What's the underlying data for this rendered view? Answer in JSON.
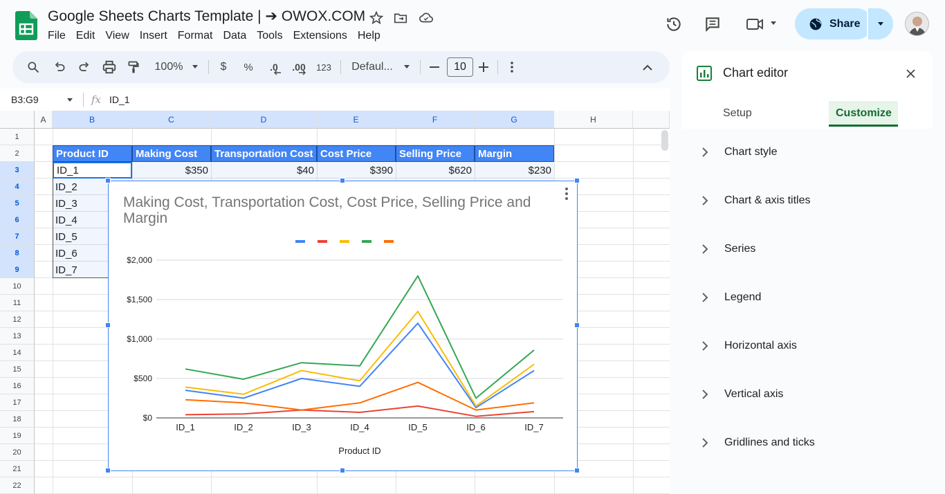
{
  "doc": {
    "title": "Google Sheets Charts Template | ➔ OWOX.COM",
    "menu": [
      "File",
      "Edit",
      "View",
      "Insert",
      "Format",
      "Data",
      "Tools",
      "Extensions",
      "Help"
    ],
    "share_label": "Share"
  },
  "toolbar": {
    "zoom": "100%",
    "currency": "$",
    "percent": "%",
    "dec_decrease": ".0",
    "dec_increase": ".00",
    "number_format": "123",
    "font": "Defaul...",
    "font_size": "10"
  },
  "formula_bar": {
    "name_box": "B3:G9",
    "fx": "fx",
    "content": "ID_1"
  },
  "grid": {
    "columns": [
      "A",
      "B",
      "C",
      "D",
      "E",
      "F",
      "G",
      "H"
    ],
    "rows": [
      "1",
      "2",
      "3",
      "4",
      "5",
      "6",
      "7",
      "8",
      "9",
      "10",
      "11",
      "12",
      "13",
      "14",
      "15",
      "16",
      "17",
      "18",
      "19",
      "20",
      "21",
      "22"
    ],
    "header_row": [
      "Product ID",
      "Making Cost",
      "Transportation Cost",
      "Cost Price",
      "Selling Price",
      "Margin"
    ],
    "row3": [
      "ID_1",
      "$350",
      "$40",
      "$390",
      "$620",
      "$230"
    ],
    "ids": [
      "ID_2",
      "ID_3",
      "ID_4",
      "ID_5",
      "ID_6",
      "ID_7"
    ]
  },
  "chart_data": {
    "type": "line",
    "title": "Making Cost, Transportation Cost, Cost Price, Selling Price and Margin",
    "xlabel": "Product ID",
    "ylabel": "",
    "categories": [
      "ID_1",
      "ID_2",
      "ID_3",
      "ID_4",
      "ID_5",
      "ID_6",
      "ID_7"
    ],
    "yticks": [
      "$0",
      "$500",
      "$1,000",
      "$1,500",
      "$2,000"
    ],
    "ylim": [
      0,
      2000
    ],
    "legend": "top",
    "grid": true,
    "series": [
      {
        "color": "#4285f4",
        "values": [
          350,
          250,
          500,
          400,
          1200,
          130,
          600
        ]
      },
      {
        "color": "#ea4335",
        "values": [
          40,
          50,
          100,
          70,
          150,
          20,
          80
        ]
      },
      {
        "color": "#fbbc04",
        "values": [
          390,
          300,
          600,
          470,
          1350,
          150,
          680
        ]
      },
      {
        "color": "#34a853",
        "values": [
          620,
          490,
          700,
          660,
          1800,
          250,
          860
        ]
      },
      {
        "color": "#ff6d01",
        "values": [
          230,
          190,
          100,
          190,
          450,
          100,
          190
        ]
      }
    ]
  },
  "editor": {
    "title": "Chart editor",
    "tabs": [
      "Setup",
      "Customize"
    ],
    "sections": [
      "Chart style",
      "Chart & axis titles",
      "Series",
      "Legend",
      "Horizontal axis",
      "Vertical axis",
      "Gridlines and ticks"
    ]
  }
}
